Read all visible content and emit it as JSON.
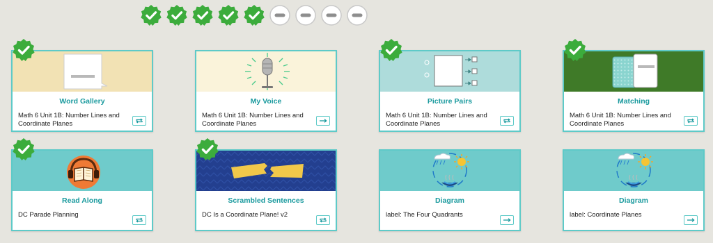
{
  "progress": {
    "completed": 5,
    "total": 9,
    "items": [
      "complete",
      "complete",
      "complete",
      "complete",
      "complete",
      "pending",
      "pending",
      "pending",
      "pending"
    ]
  },
  "colors": {
    "accent": "#5ecac8",
    "title": "#1a9a9e",
    "check_green": "#3cac3c",
    "page_bg": "#e6e5df"
  },
  "cards": [
    {
      "title": "Word Gallery",
      "description": "Math 6 Unit 1B: Number Lines and Coordinate Planes",
      "completed": true,
      "action_icon": "repeat-icon",
      "banner": "word-gallery",
      "banner_color": "#f2e2b4"
    },
    {
      "title": "My Voice",
      "description": "Math 6 Unit 1B: Number Lines and Coordinate Planes",
      "completed": false,
      "action_icon": "arrow-right-icon",
      "banner": "my-voice",
      "banner_color": "#faf3da"
    },
    {
      "title": "Picture Pairs",
      "description": "Math 6 Unit 1B: Number Lines and Coordinate Planes",
      "completed": true,
      "action_icon": "repeat-icon",
      "banner": "picture-pairs",
      "banner_color": "#aedcdb"
    },
    {
      "title": "Matching",
      "description": "Math 6 Unit 1B: Number Lines and Coordinate Planes",
      "completed": true,
      "action_icon": "repeat-icon",
      "banner": "matching",
      "banner_color": "#3f7a28"
    },
    {
      "title": "Read Along",
      "description": "DC Parade Planning",
      "completed": true,
      "action_icon": "repeat-icon",
      "banner": "read-along",
      "banner_color": "#6fcbcb"
    },
    {
      "title": "Scrambled Sentences",
      "description": "DC Is a Coordinate Plane! v2",
      "completed": true,
      "action_icon": "repeat-icon",
      "banner": "scrambled-sentences",
      "banner_color": "#233f8f"
    },
    {
      "title": "Diagram",
      "description": "label: The Four Quadrants",
      "completed": false,
      "action_icon": "arrow-right-icon",
      "banner": "diagram",
      "banner_color": "#6fcbcb"
    },
    {
      "title": "Diagram",
      "description": "label: Coordinate Planes",
      "completed": false,
      "action_icon": "arrow-right-icon",
      "banner": "diagram",
      "banner_color": "#6fcbcb"
    }
  ]
}
